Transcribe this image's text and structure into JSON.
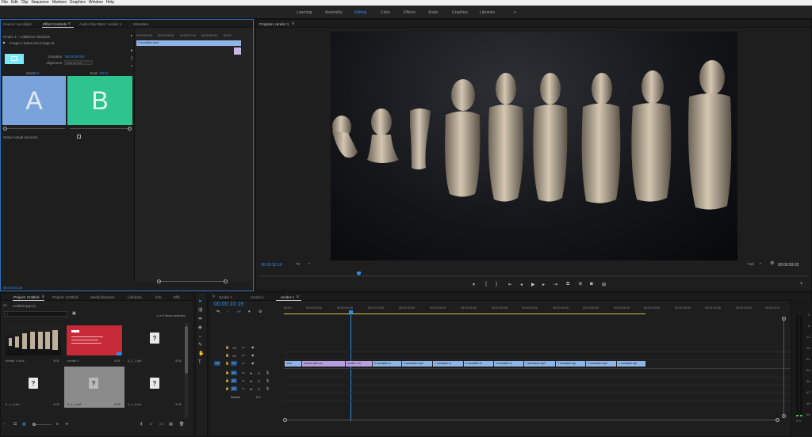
{
  "menubar": {
    "items": [
      "File",
      "Edit",
      "Clip",
      "Sequence",
      "Markers",
      "Graphics",
      "Window",
      "Help"
    ]
  },
  "workspaces": {
    "items": [
      "Learning",
      "Assembly",
      "Editing",
      "Color",
      "Effects",
      "Audio",
      "Graphics",
      "Libraries"
    ],
    "active": "Editing",
    "more": "»"
  },
  "source_panel": {
    "tabs": [
      "Source: (no clips)",
      "Effect Controls",
      "Audio Clip Mixer: render 1",
      "Metadata"
    ],
    "clip_path": "render 1 * AddMove Dissolve",
    "transition_desc": "Image A fades into Image B.",
    "duration_label": "Duration",
    "duration_value": "00:00:00:00",
    "alignment_label": "Alignment",
    "alignment_value": "End at Cut",
    "start_label": "Start:",
    "start_value": "0.0",
    "end_label": "End:",
    "end_value": "100.0",
    "a_label": "A",
    "b_label": "B",
    "show_actual_sources": "Show Actual Sources",
    "ruler": [
      "00:00:55:00",
      "00:00:56:00",
      "00:00:57:00",
      "00:00:58:00",
      "00:00"
    ],
    "mini_clip": "2 turntable.mp4",
    "timecode": "00:00:10:19"
  },
  "program_monitor": {
    "title": "Program: render 1",
    "timecode_left": "00:00:10:19",
    "fit": "Fit",
    "quality": "Full",
    "timecode_right": "00:00:59:02"
  },
  "project_panel": {
    "tabs": [
      "Project: Untitled",
      "Project: Untitled",
      "Media Browser",
      "Libraries",
      "Info",
      "Effe"
    ],
    "project_file": "Untitled.prproj",
    "items_selected": "1 of 9 items selected",
    "items": [
      {
        "name": "render 1.mov",
        "duration": "3:01",
        "kind": "video"
      },
      {
        "name": "render 1",
        "duration": "4:01",
        "kind": "sequence"
      },
      {
        "name": "5_1_1.avi",
        "duration": "4:05",
        "kind": "file"
      },
      {
        "name": "5_1_2.avi",
        "duration": "4:05",
        "kind": "file"
      },
      {
        "name": "5_1_3.avi",
        "duration": "4:05",
        "kind": "file"
      },
      {
        "name": "5_1_4.avi",
        "duration": "4:05",
        "kind": "file"
      }
    ]
  },
  "timeline": {
    "tabs": [
      "render 1",
      "render 1",
      "render 1"
    ],
    "timecode": "00:00:10:19",
    "ruler": [
      "00:00",
      "00:00:05:00",
      "00:00:10:00",
      "00:00:15:00",
      "00:00:20:00",
      "00:00:25:00",
      "00:00:30:00",
      "00:00:35:00",
      "00:00:40:00",
      "00:00:45:00",
      "00:00:50:00",
      "00:00:55:00",
      "00:01:00:00",
      "00:01:05:00",
      "00:01:10:00",
      "00:01:15:00",
      "00:01:20:0"
    ],
    "tracks": {
      "v3": "V3",
      "v2": "V2",
      "v1": "V1",
      "v1_src": "V1",
      "a1": "A1",
      "a2": "A2",
      "a3": "A3",
      "a1_src": "A1",
      "master": "Master",
      "master_val": "0.0",
      "m": "M",
      "s": "S"
    },
    "clips": [
      "rend",
      "render-tate.mo",
      "render 1.m",
      "9 turntable.m",
      "8 turntable.mp4",
      "7 turntable.m",
      "6 turntable.m",
      "5 turntable.m",
      "4 turntable.mp4",
      "3 turntable.mp",
      "2 turntable.mp4",
      "1 turntable.mp"
    ]
  },
  "meter": {
    "labels": [
      "0",
      "-6",
      "-12",
      "-18",
      "-24",
      "-30",
      "-36",
      "-42",
      "-48",
      "-54"
    ],
    "footer": "S S"
  }
}
